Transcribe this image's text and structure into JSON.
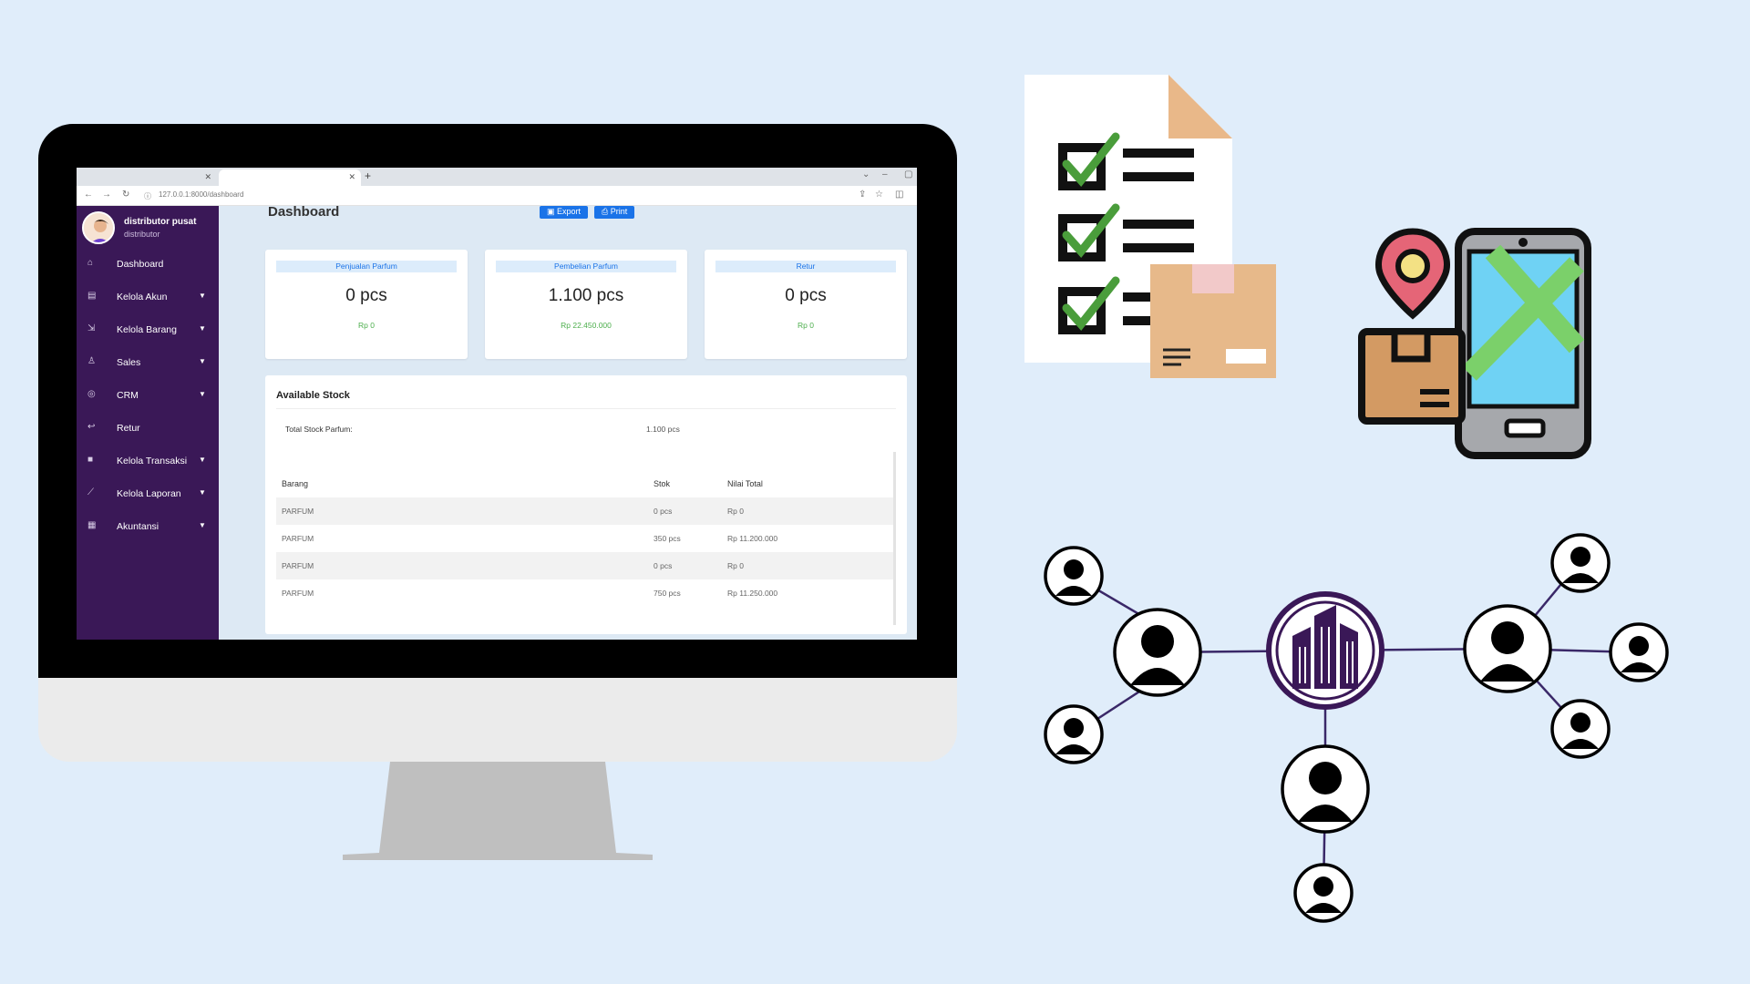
{
  "browser": {
    "url": "127.0.0.1:8000/dashboard"
  },
  "sidebar": {
    "user_name": "distributor pusat",
    "user_role": "distributor",
    "items": [
      {
        "label": "Dashboard",
        "icon": "home-icon",
        "has_caret": false
      },
      {
        "label": "Kelola Akun",
        "icon": "account-icon",
        "has_caret": true
      },
      {
        "label": "Kelola Barang",
        "icon": "box-icon",
        "has_caret": true
      },
      {
        "label": "Sales",
        "icon": "person-icon",
        "has_caret": true
      },
      {
        "label": "CRM",
        "icon": "crm-icon",
        "has_caret": true
      },
      {
        "label": "Retur",
        "icon": "return-icon",
        "has_caret": false
      },
      {
        "label": "Kelola Transaksi",
        "icon": "transaction-icon",
        "has_caret": true
      },
      {
        "label": "Kelola Laporan",
        "icon": "report-icon",
        "has_caret": true
      },
      {
        "label": "Akuntansi",
        "icon": "accounting-icon",
        "has_caret": true
      }
    ]
  },
  "main": {
    "title": "Dashboard",
    "export_label": "Export",
    "print_label": "Print",
    "stats": [
      {
        "header": "Penjualan Parfum",
        "value": "0 pcs",
        "sub": "Rp 0"
      },
      {
        "header": "Pembelian Parfum",
        "value": "1.100 pcs",
        "sub": "Rp 22.450.000"
      },
      {
        "header": "Retur",
        "value": "0 pcs",
        "sub": "Rp 0"
      }
    ],
    "stock": {
      "title": "Available Stock",
      "total_label": "Total Stock Parfum:",
      "total_value": "1.100 pcs",
      "headers": {
        "item": "Barang",
        "stock": "Stok",
        "total": "Nilai Total"
      },
      "rows": [
        {
          "item": "PARFUM",
          "stock": "0 pcs",
          "total": "Rp 0"
        },
        {
          "item": "PARFUM",
          "stock": "350 pcs",
          "total": "Rp 11.200.000"
        },
        {
          "item": "PARFUM",
          "stock": "0 pcs",
          "total": "Rp 0"
        },
        {
          "item": "PARFUM",
          "stock": "750 pcs",
          "total": "Rp 11.250.000"
        }
      ]
    }
  },
  "colors": {
    "background": "#e0edfa",
    "sidebar": "#3a1857",
    "accent": "#1a73e8",
    "success": "#4cae4c",
    "network_node": "#3a1857"
  },
  "illustrations": [
    "checklist-document-icon",
    "delivery-tracking-phone-icon",
    "distribution-network-icon"
  ]
}
